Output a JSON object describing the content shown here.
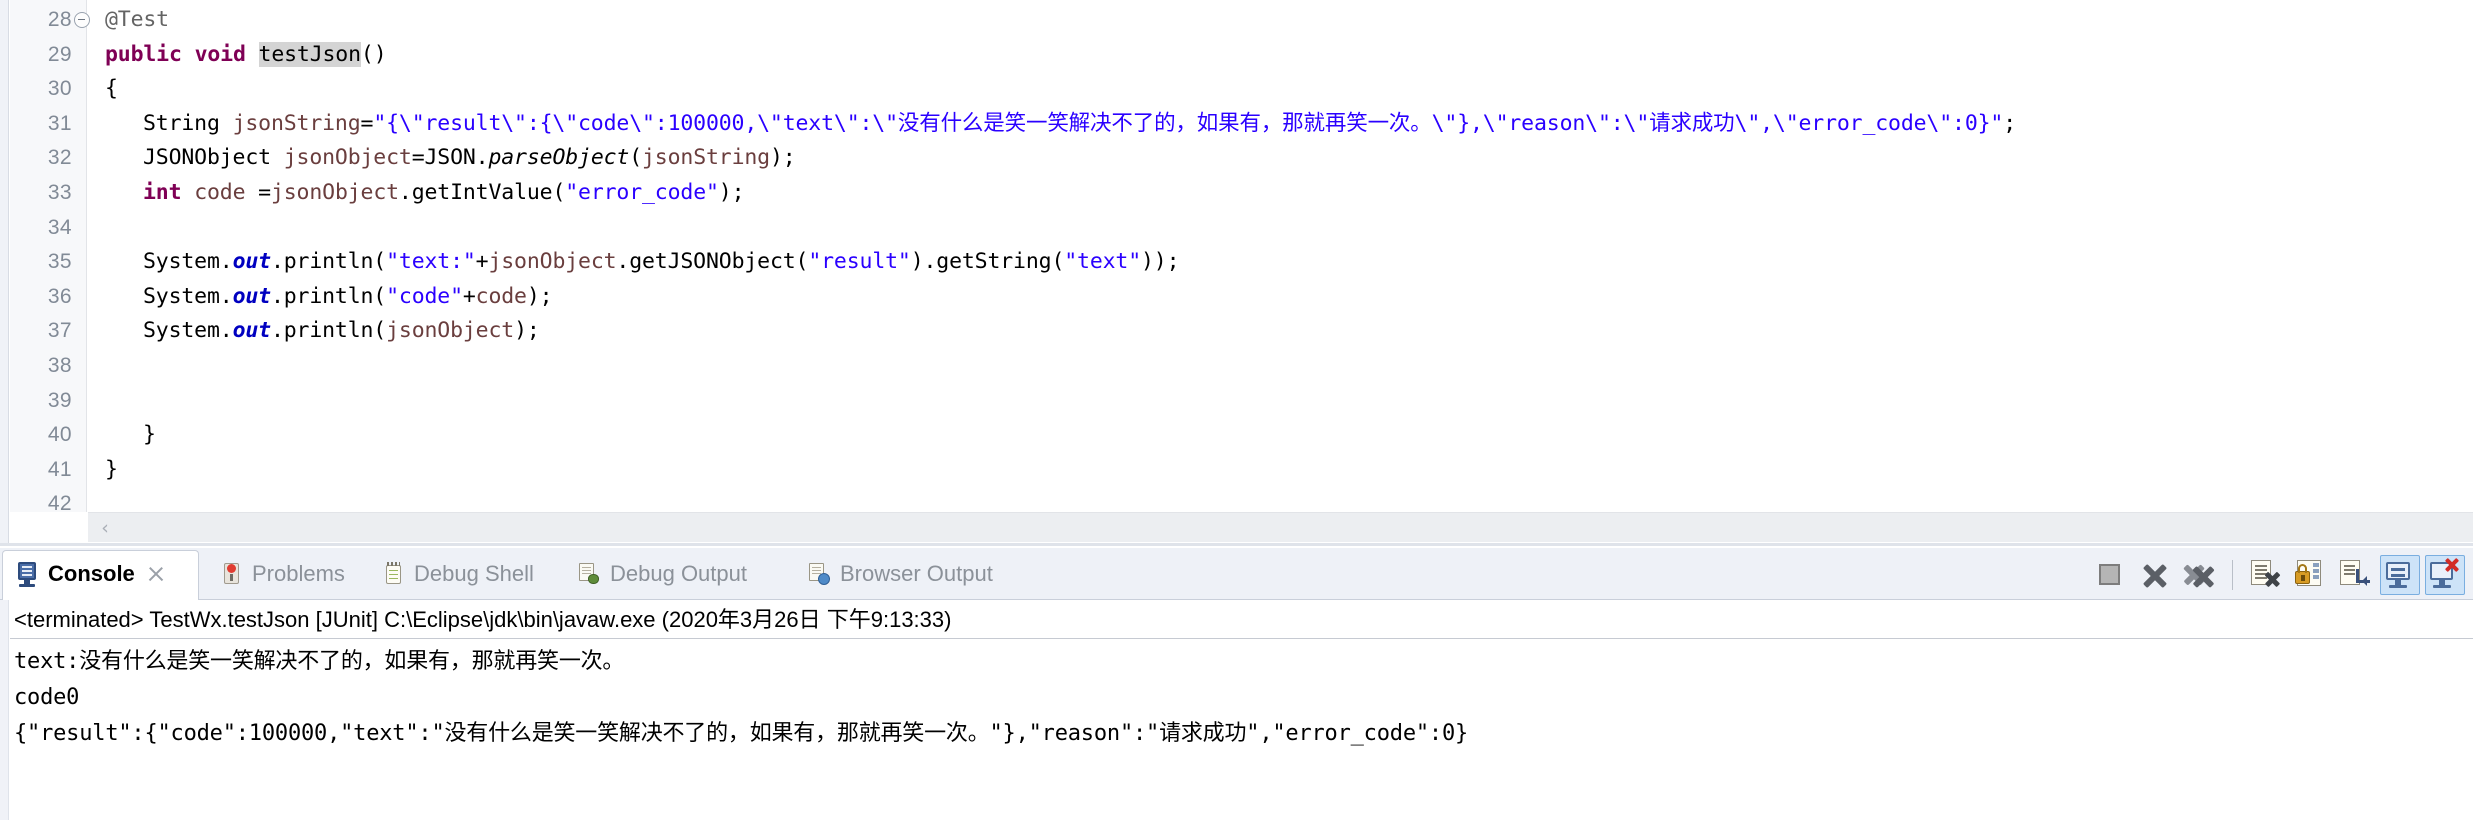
{
  "editor": {
    "lines": [
      {
        "num": "28",
        "fold": true,
        "indent": 0,
        "tokens": [
          {
            "t": "ann",
            "v": "@Test"
          }
        ]
      },
      {
        "num": "29",
        "fold": false,
        "indent": 0,
        "tokens": [
          {
            "t": "kw",
            "v": "public"
          },
          {
            "t": "plain",
            "v": " "
          },
          {
            "t": "kw",
            "v": "void"
          },
          {
            "t": "plain",
            "v": " "
          },
          {
            "t": "sel",
            "v": "testJson"
          },
          {
            "t": "plain",
            "v": "()"
          }
        ]
      },
      {
        "num": "30",
        "fold": false,
        "indent": 0,
        "tokens": [
          {
            "t": "plain",
            "v": "{"
          }
        ]
      },
      {
        "num": "31",
        "fold": false,
        "indent": 1,
        "tokens": [
          {
            "t": "plain",
            "v": "String "
          },
          {
            "t": "loc",
            "v": "jsonString"
          },
          {
            "t": "plain",
            "v": "="
          },
          {
            "t": "str",
            "v": "\"{\\\"result\\\":{\\\"code\\\":100000,\\\"text\\\":\\\"没有什么是笑一笑解决不了的，如果有，那就再笑一次。\\\"},\\\"reason\\\":\\\"请求成功\\\",\\\"error_code\\\":0}\""
          },
          {
            "t": "plain",
            "v": ";"
          }
        ]
      },
      {
        "num": "32",
        "fold": false,
        "indent": 1,
        "tokens": [
          {
            "t": "plain",
            "v": "JSONObject "
          },
          {
            "t": "loc",
            "v": "jsonObject"
          },
          {
            "t": "plain",
            "v": "=JSON."
          },
          {
            "t": "stat",
            "v": "parseObject"
          },
          {
            "t": "plain",
            "v": "("
          },
          {
            "t": "loc",
            "v": "jsonString"
          },
          {
            "t": "plain",
            "v": ");"
          }
        ]
      },
      {
        "num": "33",
        "fold": false,
        "indent": 1,
        "tokens": [
          {
            "t": "kw",
            "v": "int"
          },
          {
            "t": "plain",
            "v": " "
          },
          {
            "t": "loc",
            "v": "code"
          },
          {
            "t": "plain",
            "v": " ="
          },
          {
            "t": "loc",
            "v": "jsonObject"
          },
          {
            "t": "plain",
            "v": ".getIntValue("
          },
          {
            "t": "str",
            "v": "\"error_code\""
          },
          {
            "t": "plain",
            "v": ");"
          }
        ]
      },
      {
        "num": "34",
        "fold": false,
        "indent": 1,
        "tokens": []
      },
      {
        "num": "35",
        "fold": false,
        "indent": 1,
        "tokens": [
          {
            "t": "plain",
            "v": "System."
          },
          {
            "t": "fld",
            "v": "out"
          },
          {
            "t": "plain",
            "v": ".println("
          },
          {
            "t": "str",
            "v": "\"text:\""
          },
          {
            "t": "plain",
            "v": "+"
          },
          {
            "t": "loc",
            "v": "jsonObject"
          },
          {
            "t": "plain",
            "v": ".getJSONObject("
          },
          {
            "t": "str",
            "v": "\"result\""
          },
          {
            "t": "plain",
            "v": ").getString("
          },
          {
            "t": "str",
            "v": "\"text\""
          },
          {
            "t": "plain",
            "v": "));"
          }
        ]
      },
      {
        "num": "36",
        "fold": false,
        "indent": 1,
        "tokens": [
          {
            "t": "plain",
            "v": "System."
          },
          {
            "t": "fld",
            "v": "out"
          },
          {
            "t": "plain",
            "v": ".println("
          },
          {
            "t": "str",
            "v": "\"code\""
          },
          {
            "t": "plain",
            "v": "+"
          },
          {
            "t": "loc",
            "v": "code"
          },
          {
            "t": "plain",
            "v": ");"
          }
        ]
      },
      {
        "num": "37",
        "fold": false,
        "indent": 1,
        "tokens": [
          {
            "t": "plain",
            "v": "System."
          },
          {
            "t": "fld",
            "v": "out"
          },
          {
            "t": "plain",
            "v": ".println("
          },
          {
            "t": "loc",
            "v": "jsonObject"
          },
          {
            "t": "plain",
            "v": ");"
          }
        ]
      },
      {
        "num": "38",
        "fold": false,
        "indent": 1,
        "tokens": []
      },
      {
        "num": "39",
        "fold": false,
        "indent": 1,
        "tokens": []
      },
      {
        "num": "40",
        "fold": false,
        "indent": 1,
        "tokens": [
          {
            "t": "plain",
            "v": "}"
          }
        ]
      },
      {
        "num": "41",
        "fold": false,
        "indent": 0,
        "tokens": [
          {
            "t": "plain",
            "v": "}"
          }
        ]
      },
      {
        "num": "42",
        "fold": false,
        "indent": 0,
        "tokens": []
      }
    ],
    "hscroll_left_arrow": "‹"
  },
  "console_view": {
    "tabs": [
      {
        "label": "Console",
        "icon": "console-monitor-icon",
        "active": true,
        "closable": true
      },
      {
        "label": "Problems",
        "icon": "problems-icon",
        "active": false,
        "closable": false
      },
      {
        "label": "Debug Shell",
        "icon": "debug-shell-icon",
        "active": false,
        "closable": false
      },
      {
        "label": "Debug Output",
        "icon": "debug-output-icon",
        "active": false,
        "closable": false
      },
      {
        "label": "Browser Output",
        "icon": "browser-output-icon",
        "active": false,
        "closable": false
      }
    ],
    "toolbar": [
      {
        "name": "terminate-button",
        "icon": "terminate-icon",
        "highlighted": false
      },
      {
        "name": "remove-launch-button",
        "icon": "remove-launch-icon",
        "highlighted": false
      },
      {
        "name": "remove-all-terminated-button",
        "icon": "remove-all-icon",
        "highlighted": false
      },
      {
        "name": "separator",
        "icon": "separator",
        "highlighted": false
      },
      {
        "name": "clear-console-button",
        "icon": "clear-console-icon",
        "highlighted": false
      },
      {
        "name": "scroll-lock-button",
        "icon": "scroll-lock-icon",
        "highlighted": false
      },
      {
        "name": "pin-console-button",
        "icon": "pin-console-icon",
        "highlighted": false
      },
      {
        "name": "display-selected-console-button",
        "icon": "display-selected-icon",
        "highlighted": true
      },
      {
        "name": "open-console-button",
        "icon": "open-console-icon",
        "highlighted": true
      }
    ],
    "launch_header": "<terminated> TestWx.testJson [JUnit] C:\\Eclipse\\jdk\\bin\\javaw.exe (2020年3月26日 下午9:13:33)",
    "output_lines": [
      "text:没有什么是笑一笑解决不了的，如果有，那就再笑一次。",
      "code0",
      "{\"result\":{\"code\":100000,\"text\":\"没有什么是笑一笑解决不了的，如果有，那就再笑一次。\"},\"reason\":\"请求成功\",\"error_code\":0}"
    ]
  },
  "colors": {
    "keyword": "#7f0055",
    "string": "#2a00ff",
    "annotation": "#646464",
    "local_var": "#6a3e3e",
    "static_field": "#0000c0",
    "selection": "#d4d4d4",
    "tab_active_text": "#000000",
    "tab_inactive_text": "#8b9199",
    "panel_bg": "#eef1f7",
    "highlight_tb": "#cde3f8"
  }
}
